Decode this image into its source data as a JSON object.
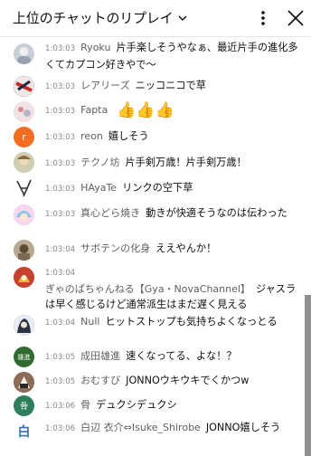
{
  "header": {
    "title": "上位のチャットのリプレイ",
    "dropdown_icon": "chevron-down-icon",
    "menu_icon": "more-vert-icon",
    "close_icon": "close-icon"
  },
  "messages": [
    {
      "time": "1:03:03",
      "author": "Ryoku",
      "text": "片手楽しそうやなぁ、最近片手の進化多くてカプコン好きやで〜",
      "avatar_color": "#c9cfd6"
    },
    {
      "time": "1:03:03",
      "author": "レアリーズ",
      "text": "ニッコニコで草",
      "avatar_color": "#d8b4b4"
    },
    {
      "time": "1:03:03",
      "author": "Fapta",
      "text": "👍👍👍",
      "avatar_color": "#e7c9c9"
    },
    {
      "time": "1:03:03",
      "author": "reon",
      "text": "嬉しそう",
      "avatar_color": "#f36d21",
      "avatar_letter": "r"
    },
    {
      "time": "1:03:03",
      "author": "テクノ坊",
      "text": "片手剣万歳！片手剣万歳！",
      "avatar_color": "#b7b79a"
    },
    {
      "time": "1:03:03",
      "author": "HAyaTe",
      "text": "リンクの空下草",
      "avatar_color": "#ffffff"
    },
    {
      "time": "1:03:03",
      "author": "真心どら焼き",
      "text": "動きが快適そうなのは伝わった",
      "avatar_color": "#d9a7d9"
    },
    {
      "time": "1:03:04",
      "author": "サボテンの化身",
      "text": "ええやんか！",
      "avatar_color": "#a89a80"
    },
    {
      "time": "1:03:04",
      "author": "ぎゃのぱちゃんねる【Gya・NovaChannel】",
      "text": "ジャスラは早く感じるけど通常派生はまだ遅く見える",
      "avatar_color": "#b33a2c"
    },
    {
      "time": "1:03:04",
      "author": "Null",
      "text": "ヒットストップも気持ちよくなっとる",
      "avatar_color": "#7d8797"
    },
    {
      "time": "1:03:05",
      "author": "成田雄進",
      "text": "速くなってる、よな！？",
      "avatar_color": "#2f6b2e",
      "avatar_letter": "雄進"
    },
    {
      "time": "1:03:05",
      "author": "おむすび",
      "text": "JONNOウキウキでくかつw",
      "avatar_color": "#7b5a4a"
    },
    {
      "time": "1:03:06",
      "author": "骨",
      "text": "デュクシデュクシ",
      "avatar_color": "#2e7d5b",
      "avatar_letter": "骨"
    },
    {
      "time": "1:03:06",
      "author": "白辺 衣介⇔Isuke_Shirobe",
      "text": "JONNO嬉しそう",
      "avatar_color": "#ffffff",
      "avatar_letter": "白"
    }
  ]
}
